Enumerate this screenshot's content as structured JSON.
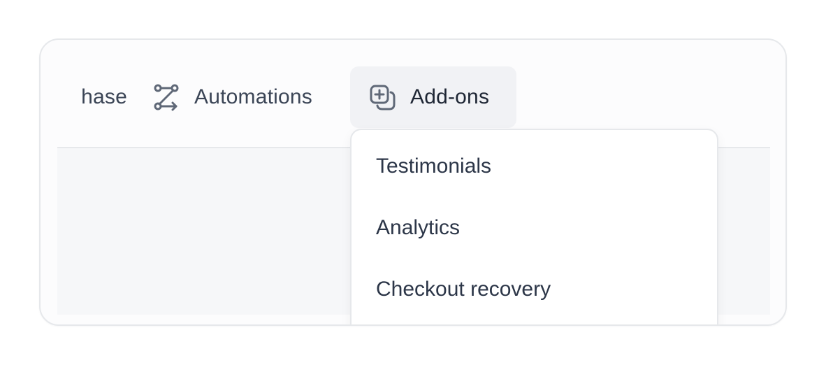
{
  "nav": {
    "items": [
      {
        "label": "Purchase",
        "visible_text": "hase",
        "icon": "none"
      },
      {
        "label": "Automations",
        "icon": "automations-route-icon"
      },
      {
        "label": "Add-ons",
        "icon": "add-square-stack-icon",
        "active": true
      }
    ]
  },
  "dropdown": {
    "items": [
      {
        "label": "Testimonials"
      },
      {
        "label": "Analytics"
      },
      {
        "label": "Checkout recovery"
      }
    ]
  },
  "colors": {
    "text": "#3b4556",
    "active_bg": "#f1f2f5",
    "panel_bg": "#f6f7f9",
    "border": "#e6e8eb"
  }
}
